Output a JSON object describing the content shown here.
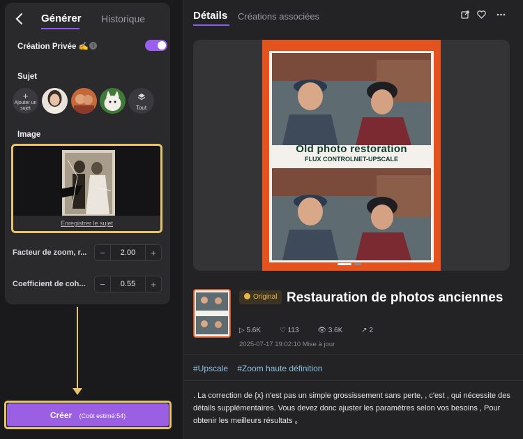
{
  "left": {
    "back_icon": "chevron-left-icon",
    "tab_generate": "Générer",
    "tab_history": "Historique",
    "private_label": "Création Privée ✍️",
    "info_icon": "i",
    "subject_label": "Sujet",
    "add_subject_plus": "+",
    "add_subject": "Ajouter un sujet",
    "all_label": "Tout",
    "image_label": "Image",
    "register_link": "Enregistrer le sujet",
    "zoom_label": "Facteur de zoom, r...",
    "zoom_value": "2.00",
    "coef_label": "Coefficient de coh...",
    "coef_value": "0.55",
    "minus": "−",
    "plus": "+",
    "create_label": "Créer",
    "create_cost": "(Coût estimé:54)"
  },
  "right": {
    "tab_details": "Détails",
    "tab_assoc": "Créations associées",
    "icons": [
      "external-link-icon",
      "heart-icon",
      "more-icon"
    ],
    "poster_title": "Old photo restoration",
    "poster_sub": "FLUX CONTROLNET-UPSCALE",
    "thumb_caption": "Old photo restoration",
    "badge": "Original",
    "title": "Restauration de photos anciennes",
    "stats": {
      "plays": "5.6K",
      "likes": "113",
      "views": "3.6K",
      "shares": "2"
    },
    "date": "2025-07-17 19:02:10 Mise à jour",
    "tags": [
      "#Upscale",
      "#Zoom haute définition"
    ],
    "description": ". La correction de {x} n'est pas un simple grossissement sans perte, , c'est ,  qui nécessite des détails supplémentaires. Vous devez donc ajuster les paramètres selon vos besoins ,  Pour obtenir les meilleurs résultats 。"
  },
  "colors": {
    "accent": "#9b5fe3",
    "highlight": "#e8c46a",
    "poster": "#e4531e"
  }
}
